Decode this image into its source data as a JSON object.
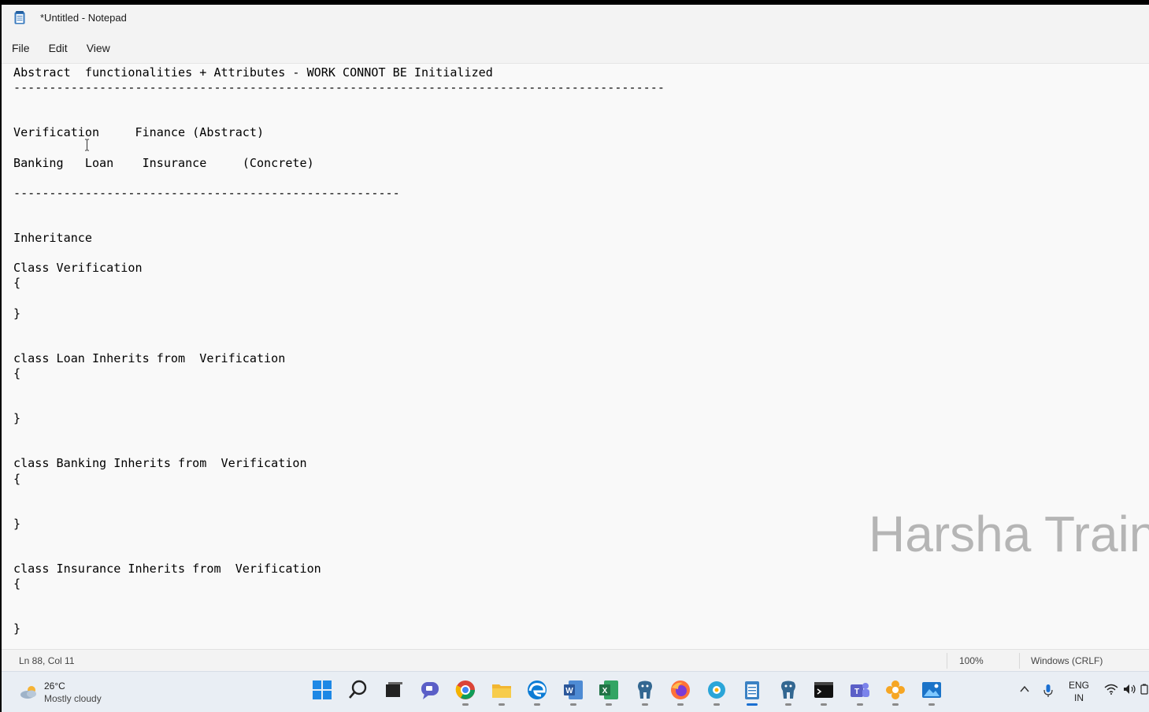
{
  "window": {
    "title": "*Untitled - Notepad"
  },
  "menu": {
    "items": [
      "File",
      "Edit",
      "View"
    ]
  },
  "editor": {
    "content": "Abstract  functionalities + Attributes - WORK CONNOT BE Initialized\n-------------------------------------------------------------------------------------------\n\n\nVerification     Finance (Abstract)\n\nBanking   Loan    Insurance     (Concrete)\n\n------------------------------------------------------\n\n\nInheritance\n\nClass Verification\n{\n\n}\n\n\nclass Loan Inherits from  Verification\n{\n\n\n}\n\n\nclass Banking Inherits from  Verification\n{\n\n\n}\n\n\nclass Insurance Inherits from  Verification\n{\n\n\n}"
  },
  "watermark": "Harsha Train",
  "status": {
    "position": "Ln 88, Col 11",
    "zoom": "100%",
    "line_ending": "Windows (CRLF)"
  },
  "taskbar": {
    "weather": {
      "temp": "26°C",
      "condition": "Mostly cloudy"
    },
    "apps": [
      {
        "name": "start-icon",
        "color": "#1e88e5"
      },
      {
        "name": "search-icon",
        "color": "#222222"
      },
      {
        "name": "task-view-icon",
        "color": "#222222"
      },
      {
        "name": "chat-icon",
        "color": "#5b5fc7"
      },
      {
        "name": "chrome-icon",
        "color": "#db4437"
      },
      {
        "name": "file-explorer-icon",
        "color": "#f2b632"
      },
      {
        "name": "edge-icon",
        "color": "#0c7cd5"
      },
      {
        "name": "word-icon",
        "color": "#2b579a"
      },
      {
        "name": "excel-icon",
        "color": "#217346"
      },
      {
        "name": "postgres-icon",
        "color": "#336791"
      },
      {
        "name": "firefox-icon",
        "color": "#ff7139"
      },
      {
        "name": "app-gear-icon",
        "color": "#2aa5d8"
      },
      {
        "name": "notepad-icon",
        "color": "#3b82c4"
      },
      {
        "name": "elephant-icon",
        "color": "#336791"
      },
      {
        "name": "terminal-icon",
        "color": "#111111"
      },
      {
        "name": "teams-icon",
        "color": "#5b5fc7"
      },
      {
        "name": "flower-app-icon",
        "color": "#f6a623"
      },
      {
        "name": "photos-icon",
        "color": "#1a73c8"
      }
    ],
    "active_app": 12,
    "language": {
      "line1": "ENG",
      "line2": "IN"
    }
  }
}
